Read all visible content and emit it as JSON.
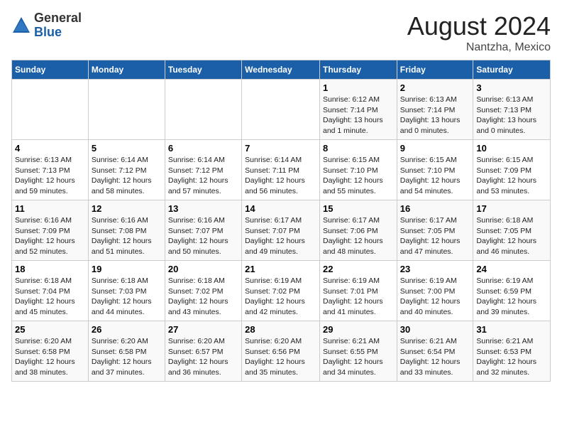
{
  "header": {
    "logo_general": "General",
    "logo_blue": "Blue",
    "month_title": "August 2024",
    "location": "Nantzha, Mexico"
  },
  "days_of_week": [
    "Sunday",
    "Monday",
    "Tuesday",
    "Wednesday",
    "Thursday",
    "Friday",
    "Saturday"
  ],
  "weeks": [
    [
      {
        "day": "",
        "info": ""
      },
      {
        "day": "",
        "info": ""
      },
      {
        "day": "",
        "info": ""
      },
      {
        "day": "",
        "info": ""
      },
      {
        "day": "1",
        "info": "Sunrise: 6:12 AM\nSunset: 7:14 PM\nDaylight: 13 hours\nand 1 minute."
      },
      {
        "day": "2",
        "info": "Sunrise: 6:13 AM\nSunset: 7:14 PM\nDaylight: 13 hours\nand 0 minutes."
      },
      {
        "day": "3",
        "info": "Sunrise: 6:13 AM\nSunset: 7:13 PM\nDaylight: 13 hours\nand 0 minutes."
      }
    ],
    [
      {
        "day": "4",
        "info": "Sunrise: 6:13 AM\nSunset: 7:13 PM\nDaylight: 12 hours\nand 59 minutes."
      },
      {
        "day": "5",
        "info": "Sunrise: 6:14 AM\nSunset: 7:12 PM\nDaylight: 12 hours\nand 58 minutes."
      },
      {
        "day": "6",
        "info": "Sunrise: 6:14 AM\nSunset: 7:12 PM\nDaylight: 12 hours\nand 57 minutes."
      },
      {
        "day": "7",
        "info": "Sunrise: 6:14 AM\nSunset: 7:11 PM\nDaylight: 12 hours\nand 56 minutes."
      },
      {
        "day": "8",
        "info": "Sunrise: 6:15 AM\nSunset: 7:10 PM\nDaylight: 12 hours\nand 55 minutes."
      },
      {
        "day": "9",
        "info": "Sunrise: 6:15 AM\nSunset: 7:10 PM\nDaylight: 12 hours\nand 54 minutes."
      },
      {
        "day": "10",
        "info": "Sunrise: 6:15 AM\nSunset: 7:09 PM\nDaylight: 12 hours\nand 53 minutes."
      }
    ],
    [
      {
        "day": "11",
        "info": "Sunrise: 6:16 AM\nSunset: 7:09 PM\nDaylight: 12 hours\nand 52 minutes."
      },
      {
        "day": "12",
        "info": "Sunrise: 6:16 AM\nSunset: 7:08 PM\nDaylight: 12 hours\nand 51 minutes."
      },
      {
        "day": "13",
        "info": "Sunrise: 6:16 AM\nSunset: 7:07 PM\nDaylight: 12 hours\nand 50 minutes."
      },
      {
        "day": "14",
        "info": "Sunrise: 6:17 AM\nSunset: 7:07 PM\nDaylight: 12 hours\nand 49 minutes."
      },
      {
        "day": "15",
        "info": "Sunrise: 6:17 AM\nSunset: 7:06 PM\nDaylight: 12 hours\nand 48 minutes."
      },
      {
        "day": "16",
        "info": "Sunrise: 6:17 AM\nSunset: 7:05 PM\nDaylight: 12 hours\nand 47 minutes."
      },
      {
        "day": "17",
        "info": "Sunrise: 6:18 AM\nSunset: 7:05 PM\nDaylight: 12 hours\nand 46 minutes."
      }
    ],
    [
      {
        "day": "18",
        "info": "Sunrise: 6:18 AM\nSunset: 7:04 PM\nDaylight: 12 hours\nand 45 minutes."
      },
      {
        "day": "19",
        "info": "Sunrise: 6:18 AM\nSunset: 7:03 PM\nDaylight: 12 hours\nand 44 minutes."
      },
      {
        "day": "20",
        "info": "Sunrise: 6:18 AM\nSunset: 7:02 PM\nDaylight: 12 hours\nand 43 minutes."
      },
      {
        "day": "21",
        "info": "Sunrise: 6:19 AM\nSunset: 7:02 PM\nDaylight: 12 hours\nand 42 minutes."
      },
      {
        "day": "22",
        "info": "Sunrise: 6:19 AM\nSunset: 7:01 PM\nDaylight: 12 hours\nand 41 minutes."
      },
      {
        "day": "23",
        "info": "Sunrise: 6:19 AM\nSunset: 7:00 PM\nDaylight: 12 hours\nand 40 minutes."
      },
      {
        "day": "24",
        "info": "Sunrise: 6:19 AM\nSunset: 6:59 PM\nDaylight: 12 hours\nand 39 minutes."
      }
    ],
    [
      {
        "day": "25",
        "info": "Sunrise: 6:20 AM\nSunset: 6:58 PM\nDaylight: 12 hours\nand 38 minutes."
      },
      {
        "day": "26",
        "info": "Sunrise: 6:20 AM\nSunset: 6:58 PM\nDaylight: 12 hours\nand 37 minutes."
      },
      {
        "day": "27",
        "info": "Sunrise: 6:20 AM\nSunset: 6:57 PM\nDaylight: 12 hours\nand 36 minutes."
      },
      {
        "day": "28",
        "info": "Sunrise: 6:20 AM\nSunset: 6:56 PM\nDaylight: 12 hours\nand 35 minutes."
      },
      {
        "day": "29",
        "info": "Sunrise: 6:21 AM\nSunset: 6:55 PM\nDaylight: 12 hours\nand 34 minutes."
      },
      {
        "day": "30",
        "info": "Sunrise: 6:21 AM\nSunset: 6:54 PM\nDaylight: 12 hours\nand 33 minutes."
      },
      {
        "day": "31",
        "info": "Sunrise: 6:21 AM\nSunset: 6:53 PM\nDaylight: 12 hours\nand 32 minutes."
      }
    ]
  ]
}
